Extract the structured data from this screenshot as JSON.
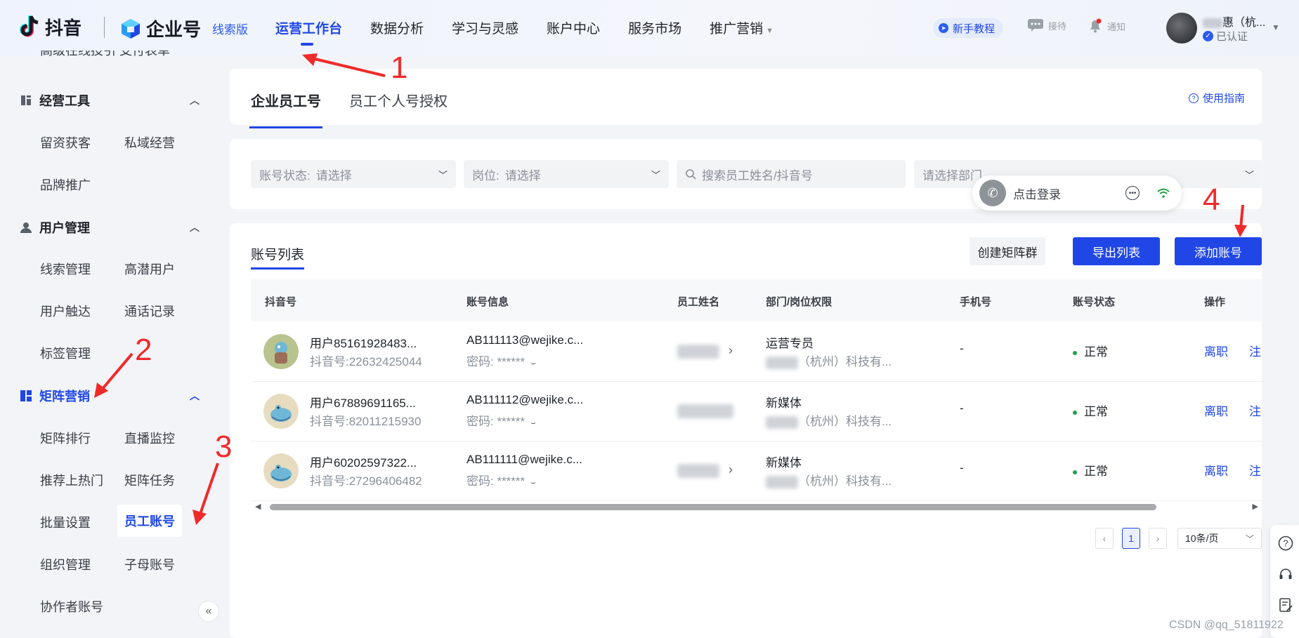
{
  "header": {
    "douyin_logo": "抖音",
    "qiye_logo": "企业号",
    "edition_tag": "线索版",
    "nav": [
      {
        "label": "运营工作台",
        "active": true
      },
      {
        "label": "数据分析"
      },
      {
        "label": "学习与灵感"
      },
      {
        "label": "账户中心"
      },
      {
        "label": "服务市场"
      },
      {
        "label": "推广营销"
      }
    ],
    "tutorial": "新手教程",
    "reception": "接待",
    "notify": "通知",
    "user_name_suffix": "惠（杭...",
    "verified": "已认证",
    "accent_color": "#2047e6"
  },
  "sidebar": {
    "cut_text": "高级在线投引  支付表单",
    "groups": [
      {
        "label": "经营工具",
        "items": [
          "留资获客",
          "私域经营",
          "品牌推广"
        ]
      },
      {
        "label": "用户管理",
        "items": [
          "线索管理",
          "高潜用户",
          "用户触达",
          "通话记录",
          "标签管理"
        ]
      },
      {
        "label": "矩阵营销",
        "active": true,
        "items": [
          "矩阵排行",
          "直播监控",
          "推荐上热门",
          "矩阵任务",
          "批量设置",
          "员工账号",
          "组织管理",
          "子母账号",
          "协作者账号"
        ]
      }
    ],
    "active_item": "员工账号"
  },
  "tabs": [
    {
      "label": "企业员工号",
      "active": true
    },
    {
      "label": "员工个人号授权"
    }
  ],
  "guide_link": "使用指南",
  "filters": {
    "status_label": "账号状态:",
    "status_placeholder": "请选择",
    "post_label": "岗位:",
    "post_placeholder": "请选择",
    "search_placeholder": "搜索员工姓名/抖音号",
    "dept_placeholder": "请选择部门"
  },
  "float_widget": {
    "label": "点击登录"
  },
  "list": {
    "title": "账号列表",
    "buttons": {
      "create_group": "创建矩阵群",
      "export": "导出列表",
      "add": "添加账号"
    },
    "columns": [
      "抖音号",
      "账号信息",
      "员工姓名",
      "部门/岗位权限",
      "手机号",
      "账号状态",
      "操作"
    ],
    "rows": [
      {
        "nick": "用户85161928483...",
        "dyid": "抖音号:22632425044",
        "account": "AB111113@wejike.c...",
        "password": "密码:  ******",
        "post": "运营专员",
        "dept": "（杭州）科技有...",
        "phone": "-",
        "status": "正常",
        "action1": "离职",
        "action2": "注"
      },
      {
        "nick": "用户67889691165...",
        "dyid": "抖音号:82011215930",
        "account": "AB111112@wejike.c...",
        "password": "密码:  ******",
        "post": "新媒体",
        "dept": "（杭州）科技有...",
        "phone": "-",
        "status": "正常",
        "action1": "离职",
        "action2": "注"
      },
      {
        "nick": "用户60202597322...",
        "dyid": "抖音号:27296406482",
        "account": "AB111111@wejike.c...",
        "password": "密码:  ******",
        "post": "新媒体",
        "dept": "（杭州）科技有...",
        "phone": "-",
        "status": "正常",
        "action1": "离职",
        "action2": "注"
      }
    ],
    "status_color": "#21a04a"
  },
  "pagination": {
    "current": "1",
    "page_size": "10条/页"
  },
  "annotations": {
    "n1": "1",
    "n2": "2",
    "n3": "3",
    "n4": "4",
    "color": "#f02a2a"
  },
  "watermark": "CSDN @qq_51811922"
}
